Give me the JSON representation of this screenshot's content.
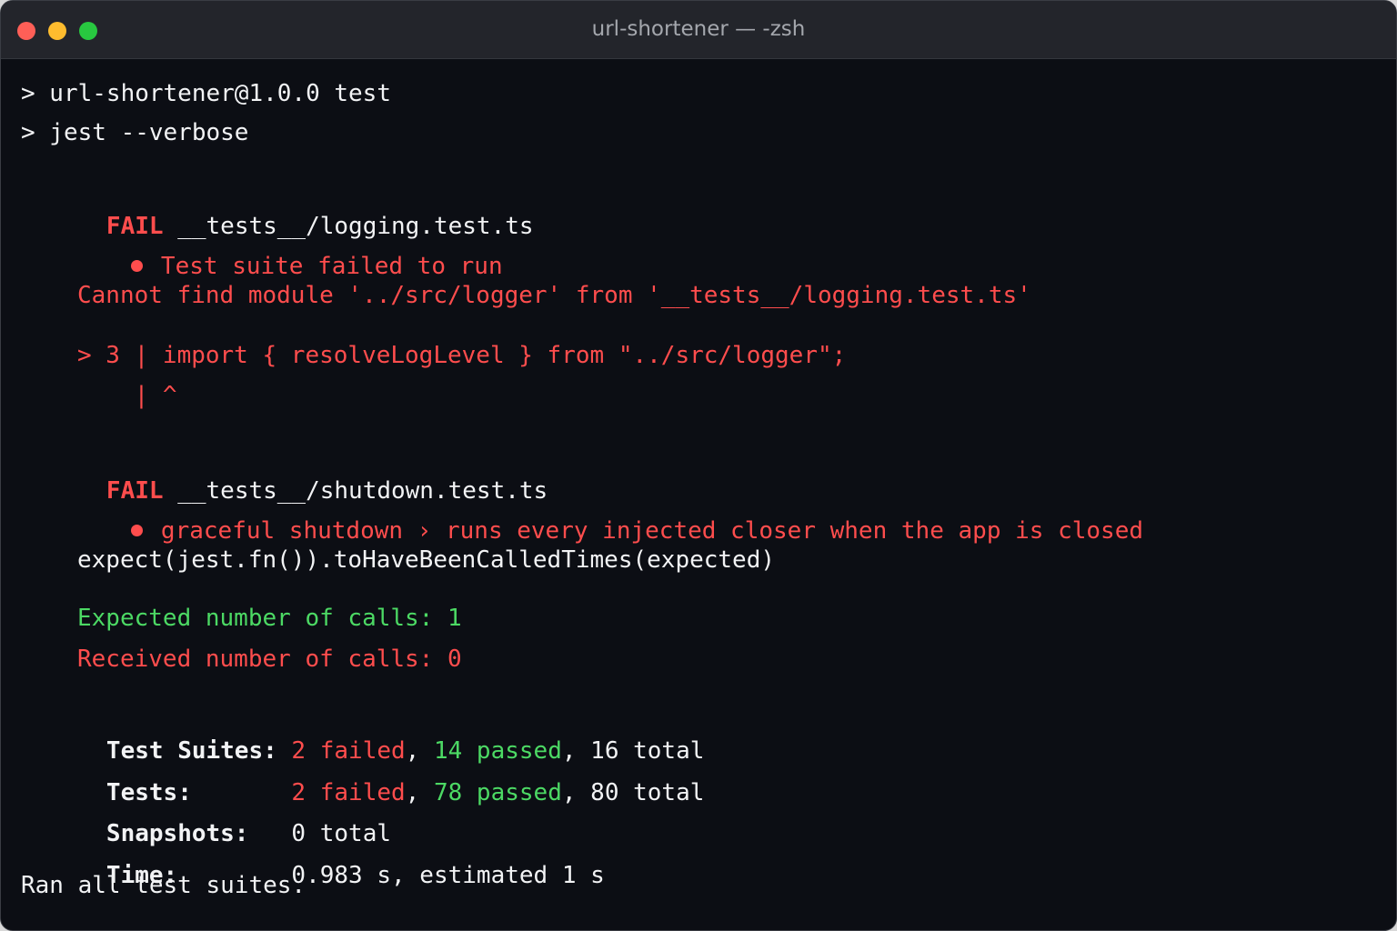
{
  "window": {
    "title": "url-shortener — -zsh"
  },
  "colors": {
    "background": "#0c0e14",
    "fail_red": "#ff4d4d",
    "pass_green": "#4cd964",
    "text": "#f2f3f5"
  },
  "terminal": {
    "cmd1": "> url-shortener@1.0.0 test",
    "cmd2": "> jest --verbose",
    "suite1": {
      "status": "FAIL",
      "file": " __tests__/logging.test.ts",
      "bullet_title": "Test suite failed to run",
      "message": "Cannot find module '../src/logger' from '__tests__/logging.test.ts'",
      "code_line": "> 3 | import { resolveLogLevel } from \"../src/logger\";",
      "caret_line": "    | ^"
    },
    "suite2": {
      "status": "FAIL",
      "file": " __tests__/shutdown.test.ts",
      "bullet_title": "graceful shutdown › runs every injected closer when the app is closed",
      "expect_line": "expect(jest.fn()).toHaveBeenCalledTimes(expected)",
      "expected_line": "Expected number of calls: 1",
      "received_line": "Received number of calls: 0"
    },
    "summary": {
      "suites_label": "Test Suites: ",
      "suites_failed": "2 failed",
      "suites_sep1": ", ",
      "suites_passed": "14 passed",
      "suites_total": ", 16 total",
      "tests_label": "Tests:       ",
      "tests_failed": "2 failed",
      "tests_sep1": ", ",
      "tests_passed": "78 passed",
      "tests_total": ", 80 total",
      "snapshots_label": "Snapshots:   ",
      "snapshots_value": "0 total",
      "time_label": "Time:        ",
      "time_value": "0.983 s, estimated 1 s",
      "ran": "Ran all test suites."
    }
  }
}
